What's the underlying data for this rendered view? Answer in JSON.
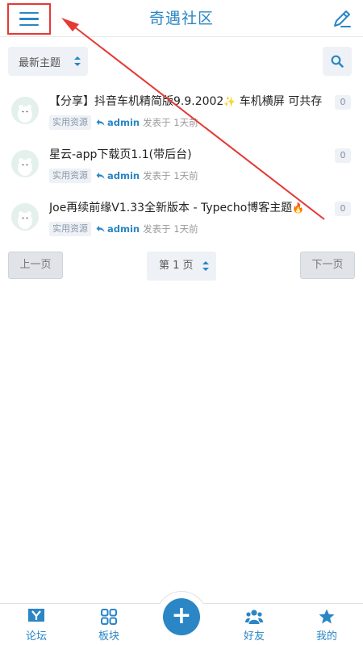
{
  "header": {
    "title": "奇遇社区",
    "menu_icon": "hamburger-icon",
    "compose_icon": "pencil-icon"
  },
  "filter": {
    "sort_label": "最新主题",
    "search_icon": "search-icon"
  },
  "posts": [
    {
      "title": "【分享】抖音车机精简版9.9.2002",
      "emoji": "✨",
      "title_suffix": "车机横屏 可共存",
      "tag": "实用资源",
      "author": "admin",
      "time": "发表于 1天前",
      "count": "0"
    },
    {
      "title": "星云-app下载页1.1(带后台)",
      "tag": "实用资源",
      "author": "admin",
      "time": "发表于 1天前",
      "count": "0"
    },
    {
      "title": "Joe再续前缘V1.33全新版本 - Typecho博客主题",
      "emoji": "🔥",
      "tag": "实用资源",
      "author": "admin",
      "time": "发表于 1天前",
      "count": "0"
    }
  ],
  "pager": {
    "prev": "上一页",
    "current": "第 1 页",
    "next": "下一页"
  },
  "bottom_nav": {
    "forum": "论坛",
    "boards": "板块",
    "add": "+",
    "friends": "好友",
    "mine": "我的"
  },
  "colors": {
    "accent": "#2a86c5",
    "highlight": "#e53935"
  }
}
